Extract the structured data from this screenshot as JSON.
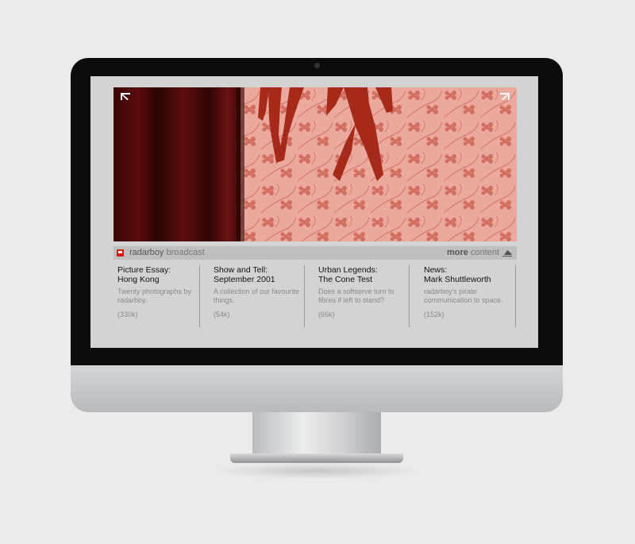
{
  "brand": {
    "name_dark": "radarboy",
    "name_light": "broadcast"
  },
  "more": {
    "bold": "more",
    "light": "content"
  },
  "items": [
    {
      "title1": "Picture Essay:",
      "title2": "Hong Kong",
      "desc": "Twenty photographs by radarboy.",
      "size": "(330k)"
    },
    {
      "title1": "Show and Tell:",
      "title2": "September 2001",
      "desc": "A collection of our favourite things.",
      "size": "(54k)"
    },
    {
      "title1": "Urban Legends:",
      "title2": "The Cone Test",
      "desc": "Does a softserve turn to fibres if left to stand?",
      "size": "(66k)"
    },
    {
      "title1": "News:",
      "title2": "Mark Shuttleworth",
      "desc": "radarboy's pirate communication to space.",
      "size": "(152k)"
    }
  ],
  "colors": {
    "accent": "#dd1111",
    "banner_wall": "#e8a496",
    "curtain": "#4a0a0a",
    "screen_bg": "#d3d3d3"
  },
  "icons": [
    "corner-top-left-icon",
    "corner-top-right-icon",
    "radarboy-logo-icon",
    "more-arrow-icon"
  ]
}
